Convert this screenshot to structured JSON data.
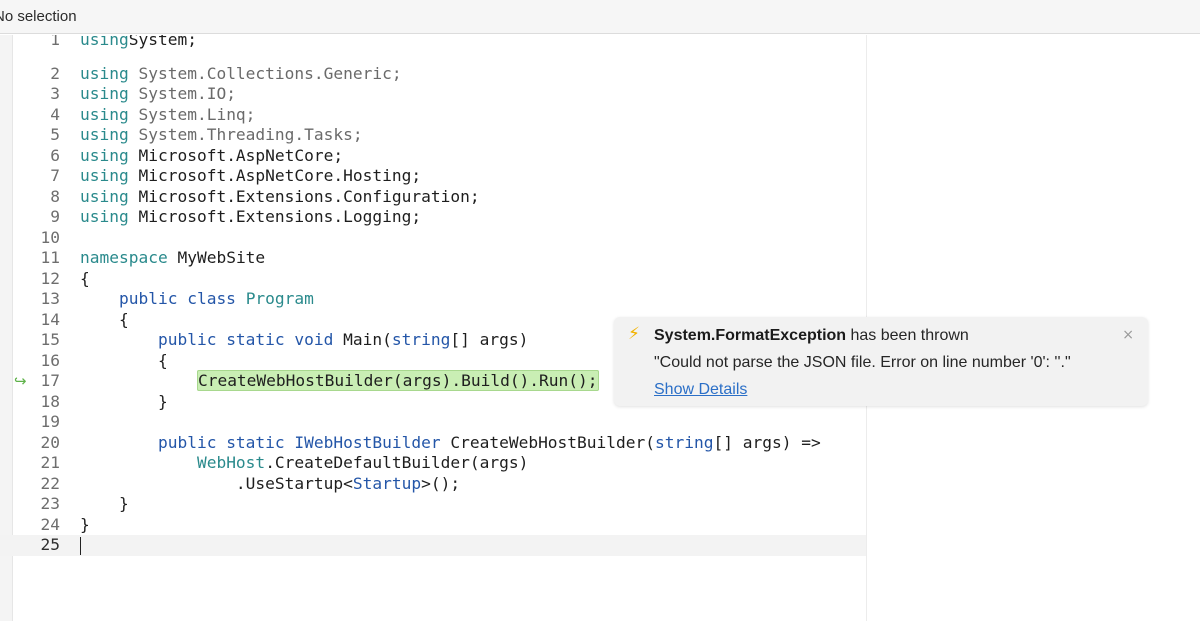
{
  "topbar": {
    "selection_label": "No selection"
  },
  "editor": {
    "lines": [
      {
        "num": "1",
        "tokens": [
          [
            "kw",
            "using"
          ],
          [
            "",
            "System;"
          ]
        ]
      },
      {
        "num": "2",
        "tokens": [
          [
            "kw",
            "using"
          ],
          [
            "faded",
            " System.Collections.Generic;"
          ]
        ]
      },
      {
        "num": "3",
        "tokens": [
          [
            "kw",
            "using"
          ],
          [
            "faded",
            " System.IO;"
          ]
        ]
      },
      {
        "num": "4",
        "tokens": [
          [
            "kw",
            "using"
          ],
          [
            "faded",
            " System.Linq;"
          ]
        ]
      },
      {
        "num": "5",
        "tokens": [
          [
            "kw",
            "using"
          ],
          [
            "faded",
            " System.Threading.Tasks;"
          ]
        ]
      },
      {
        "num": "6",
        "tokens": [
          [
            "kw",
            "using"
          ],
          [
            "",
            " Microsoft.AspNetCore;"
          ]
        ]
      },
      {
        "num": "7",
        "tokens": [
          [
            "kw",
            "using"
          ],
          [
            "",
            " Microsoft.AspNetCore.Hosting;"
          ]
        ]
      },
      {
        "num": "8",
        "tokens": [
          [
            "kw",
            "using"
          ],
          [
            "",
            " Microsoft.Extensions.Configuration;"
          ]
        ]
      },
      {
        "num": "9",
        "tokens": [
          [
            "kw",
            "using"
          ],
          [
            "",
            " Microsoft.Extensions.Logging;"
          ]
        ]
      },
      {
        "num": "10",
        "tokens": []
      },
      {
        "num": "11",
        "tokens": [
          [
            "kw",
            "namespace"
          ],
          [
            "",
            " MyWebSite"
          ]
        ]
      },
      {
        "num": "12",
        "tokens": [
          [
            "",
            "{"
          ]
        ]
      },
      {
        "num": "13",
        "tokens": [
          [
            "",
            "    "
          ],
          [
            "kw-blue",
            "public class"
          ],
          [
            "",
            " "
          ],
          [
            "type",
            "Program"
          ]
        ]
      },
      {
        "num": "14",
        "tokens": [
          [
            "",
            "    {"
          ]
        ]
      },
      {
        "num": "15",
        "tokens": [
          [
            "",
            "        "
          ],
          [
            "kw-blue",
            "public static void"
          ],
          [
            "",
            " Main("
          ],
          [
            "kw-blue",
            "string"
          ],
          [
            "",
            "[] args)"
          ]
        ]
      },
      {
        "num": "16",
        "tokens": [
          [
            "",
            "        {"
          ]
        ]
      },
      {
        "num": "17",
        "tokens": [
          [
            "",
            "            "
          ],
          [
            "hl",
            "CreateWebHostBuilder(args).Build().Run();"
          ]
        ]
      },
      {
        "num": "18",
        "tokens": [
          [
            "",
            "        }"
          ]
        ]
      },
      {
        "num": "19",
        "tokens": []
      },
      {
        "num": "20",
        "tokens": [
          [
            "",
            "        "
          ],
          [
            "kw-blue",
            "public static"
          ],
          [
            "",
            " "
          ],
          [
            "kw-blue",
            "IWebHostBuilder"
          ],
          [
            "",
            " CreateWebHostBuilder("
          ],
          [
            "kw-blue",
            "string"
          ],
          [
            "",
            "[] args) =>"
          ]
        ]
      },
      {
        "num": "21",
        "tokens": [
          [
            "",
            "            "
          ],
          [
            "type",
            "WebHost"
          ],
          [
            "",
            ".CreateDefaultBuilder(args)"
          ]
        ]
      },
      {
        "num": "22",
        "tokens": [
          [
            "",
            "                .UseStartup<"
          ],
          [
            "kw-blue",
            "Startup"
          ],
          [
            "",
            ">();"
          ]
        ]
      },
      {
        "num": "23",
        "tokens": [
          [
            "",
            "    }"
          ]
        ]
      },
      {
        "num": "24",
        "tokens": [
          [
            "",
            "}"
          ]
        ]
      },
      {
        "num": "25",
        "tokens": []
      }
    ],
    "current_line": "25",
    "execution_line": "17",
    "execution_marker": "↪"
  },
  "exception_popup": {
    "exception_type": "System.FormatException",
    "title_suffix": " has been thrown",
    "message": "\"Could not parse the JSON file. Error on line number '0': ''.\"",
    "link_label": "Show Details",
    "close_glyph": "×",
    "bolt_glyph": "⚡"
  }
}
